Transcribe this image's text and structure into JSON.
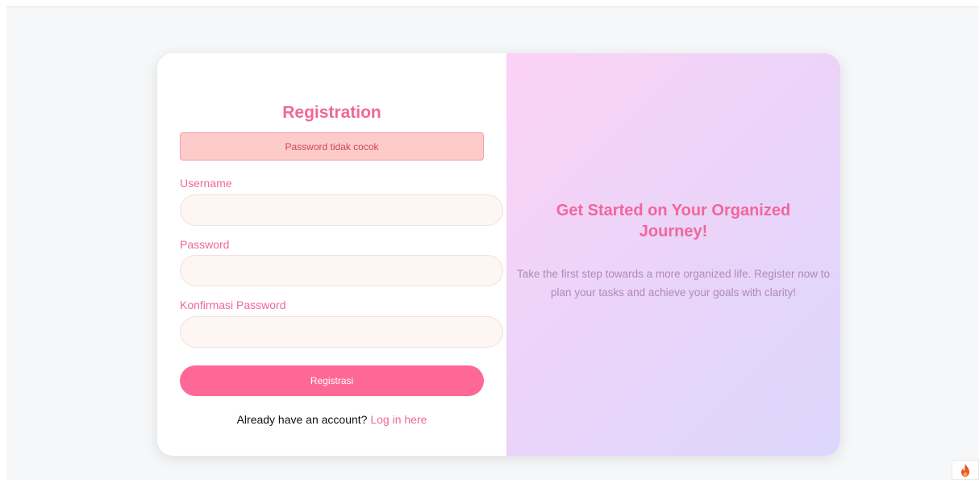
{
  "form": {
    "title": "Registration",
    "alert_message": "Password tidak cocok",
    "fields": {
      "username": {
        "label": "Username",
        "value": "",
        "placeholder": ""
      },
      "password": {
        "label": "Password",
        "value": "",
        "placeholder": ""
      },
      "confirm_password": {
        "label": "Konfirmasi Password",
        "value": "",
        "placeholder": ""
      }
    },
    "submit_label": "Registrasi",
    "login_prompt": "Already have an account?",
    "login_link": "Log in here"
  },
  "info": {
    "title": "Get Started on Your Organized Journey!",
    "description": "Take the first step towards a more organized life. Register now to plan your tasks and achieve your goals with clarity!"
  },
  "colors": {
    "accent": "#f0679b",
    "button": "#fe6897",
    "alert_bg": "#fecbcb",
    "input_bg": "#fef6f2"
  },
  "icons": {
    "corner_badge": "flame-icon"
  }
}
